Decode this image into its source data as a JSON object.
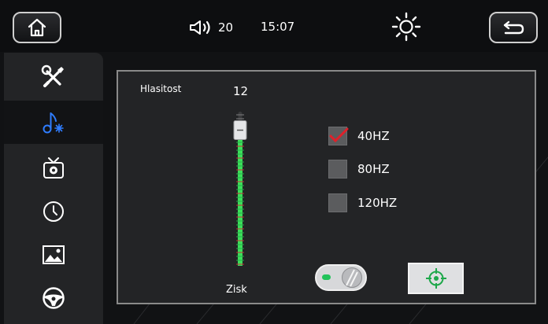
{
  "status": {
    "volume": "20",
    "time": "15:07"
  },
  "icons": {
    "home": "home-icon",
    "speaker": "speaker-icon",
    "brightness": "sun-icon",
    "back": "back-arrow-icon"
  },
  "sidebar": {
    "items": [
      {
        "name": "tools",
        "icon": "tools-icon"
      },
      {
        "name": "audio",
        "icon": "music-settings-icon",
        "active": true
      },
      {
        "name": "tv",
        "icon": "tv-settings-icon"
      },
      {
        "name": "clock",
        "icon": "clock-icon"
      },
      {
        "name": "picture",
        "icon": "picture-icon"
      },
      {
        "name": "steering",
        "icon": "steering-wheel-icon"
      }
    ]
  },
  "subwoofer": {
    "volume_label": "Hlasitost",
    "volume_value": "12",
    "gain_label": "Zisk",
    "level": 0.88,
    "frequencies": [
      {
        "label": "40HZ",
        "checked": true
      },
      {
        "label": "80HZ",
        "checked": false
      },
      {
        "label": "120HZ",
        "checked": false
      }
    ],
    "enabled": true
  },
  "colors": {
    "accent_blue": "#2f7dff",
    "slider_green": "#3be05a",
    "check_red": "#e0202a",
    "toggle_green": "#22c35a",
    "target_green": "#1ea84a"
  }
}
